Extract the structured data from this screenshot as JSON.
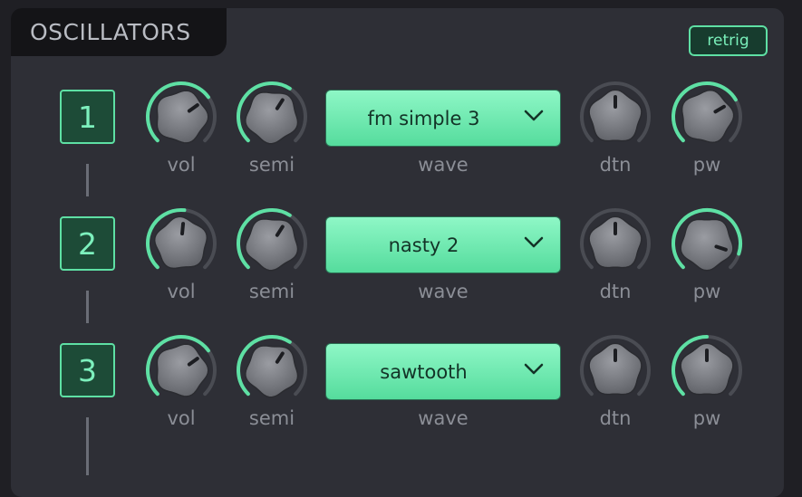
{
  "panel": {
    "title": "OSCILLATORS",
    "retrig_label": "retrig"
  },
  "labels": {
    "vol": "vol",
    "semi": "semi",
    "wave": "wave",
    "dtn": "dtn",
    "pw": "pw"
  },
  "oscillators": [
    {
      "number": "1",
      "wave": "fm simple 3",
      "vol": 0.7,
      "semi": 0.62,
      "dtn": 0.5,
      "pw": 0.72
    },
    {
      "number": "2",
      "wave": "nasty 2",
      "vol": 0.52,
      "semi": 0.62,
      "dtn": 0.5,
      "pw": 0.9
    },
    {
      "number": "3",
      "wave": "sawtooth",
      "vol": 0.7,
      "semi": 0.62,
      "dtn": 0.5,
      "pw": 0.5
    }
  ],
  "colors": {
    "accent": "#5ee0a4",
    "knob_body": "#7b7d83",
    "track": "#4a4c53",
    "panel": "#2e2f36"
  }
}
